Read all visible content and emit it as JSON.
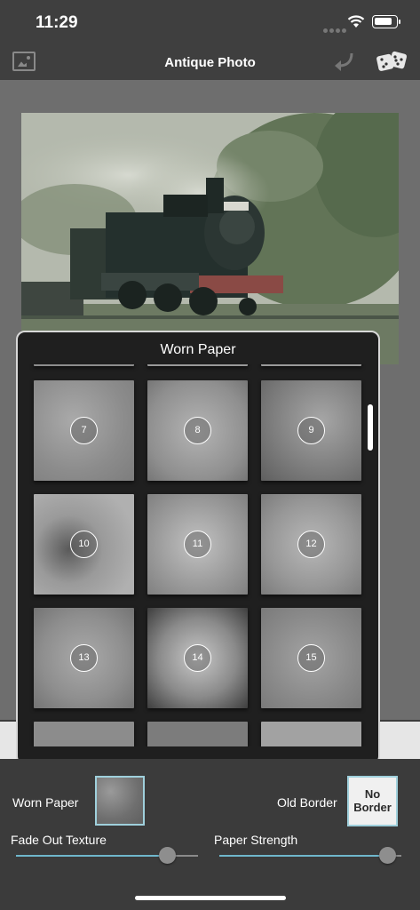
{
  "status": {
    "time": "11:29"
  },
  "nav": {
    "title": "Antique Photo"
  },
  "popup": {
    "title": "Worn Paper",
    "tiles": [
      {
        "label": "7"
      },
      {
        "label": "8"
      },
      {
        "label": "9"
      },
      {
        "label": "10"
      },
      {
        "label": "11"
      },
      {
        "label": "12"
      },
      {
        "label": "13"
      },
      {
        "label": "14"
      },
      {
        "label": "15"
      }
    ]
  },
  "controls": {
    "texture_label": "Worn Paper",
    "border_label": "Old Border",
    "border_button_line1": "No",
    "border_button_line2": "Border",
    "fade_label": "Fade Out Texture",
    "strength_label": "Paper Strength",
    "fade_value": 0.83,
    "strength_value": 0.92
  },
  "colors": {
    "accent": "#6fb7cc",
    "swatch_border": "#9fd0dc"
  }
}
